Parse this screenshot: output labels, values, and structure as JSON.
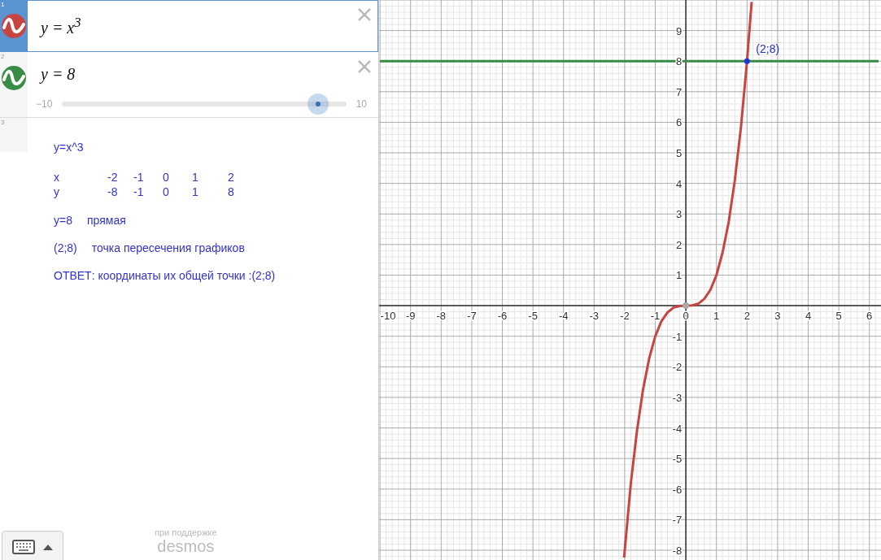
{
  "expressions": [
    {
      "index": "1",
      "kind": "expression",
      "selected": true,
      "color": "#c74440",
      "formula": "y = x$^{3}$"
    },
    {
      "index": "2",
      "kind": "slider",
      "selected": false,
      "color": "#388c46",
      "formula": "y = 8",
      "slider": {
        "min": "−10",
        "max": "10",
        "level": 0.9
      }
    },
    {
      "index": "3",
      "kind": "note",
      "selected": false,
      "title": "y=x^3",
      "table": [
        [
          "x",
          "-2",
          "-1",
          "0",
          "1",
          "2"
        ],
        [
          "y",
          "-8",
          "-1",
          "0",
          "1",
          "8"
        ]
      ],
      "lines": [
        [
          "y=8",
          "прямая"
        ],
        [
          "(2;8)",
          "точка пересечения графиков"
        ],
        [
          "ОТВЕТ: координаты их общей точки :(2;8)"
        ]
      ]
    }
  ],
  "footer": {
    "powered_by": "при поддержке",
    "brand": "desmos"
  },
  "graph": {
    "chart_data": {
      "type": "line",
      "grid": true,
      "xlim": [
        -10.03,
        6.38
      ],
      "ylim": [
        -8.32,
        10
      ],
      "xticks": [
        -10,
        -9,
        -8,
        -7,
        -6,
        -5,
        -4,
        -3,
        -2,
        -1,
        0,
        1,
        2,
        3,
        4,
        5,
        6
      ],
      "yticks": [
        -8,
        -7,
        -6,
        -5,
        -4,
        -3,
        -2,
        -1,
        1,
        2,
        3,
        4,
        5,
        6,
        7,
        8,
        9
      ],
      "x": [
        -10,
        -2.02,
        -1.8,
        -1.6,
        -1.4,
        -1.2,
        -1,
        -0.8,
        -0.6,
        -0.4,
        -0.2,
        0,
        0.2,
        0.4,
        0.6,
        0.8,
        1,
        1.2,
        1.4,
        1.6,
        1.8,
        2,
        2.15,
        6.3
      ],
      "series": [
        {
          "color": "#c74440",
          "values": [
            null,
            -8.24,
            -5.83,
            -4.1,
            -2.74,
            -1.73,
            -1,
            -0.51,
            -0.22,
            -0.06,
            -0.01,
            0,
            0.01,
            0.06,
            0.22,
            0.51,
            1,
            1.73,
            2.74,
            4.1,
            5.83,
            8,
            9.94,
            null
          ]
        },
        {
          "color": "#388c46",
          "values": [
            8,
            8,
            8,
            8,
            8,
            8,
            8,
            8,
            8,
            8,
            8,
            8,
            8,
            8,
            8,
            8,
            8,
            8,
            8,
            8,
            8,
            8,
            8,
            8
          ]
        }
      ],
      "annotations": [
        {
          "x": 2,
          "y": 8,
          "text": "(2;8)"
        }
      ]
    }
  }
}
